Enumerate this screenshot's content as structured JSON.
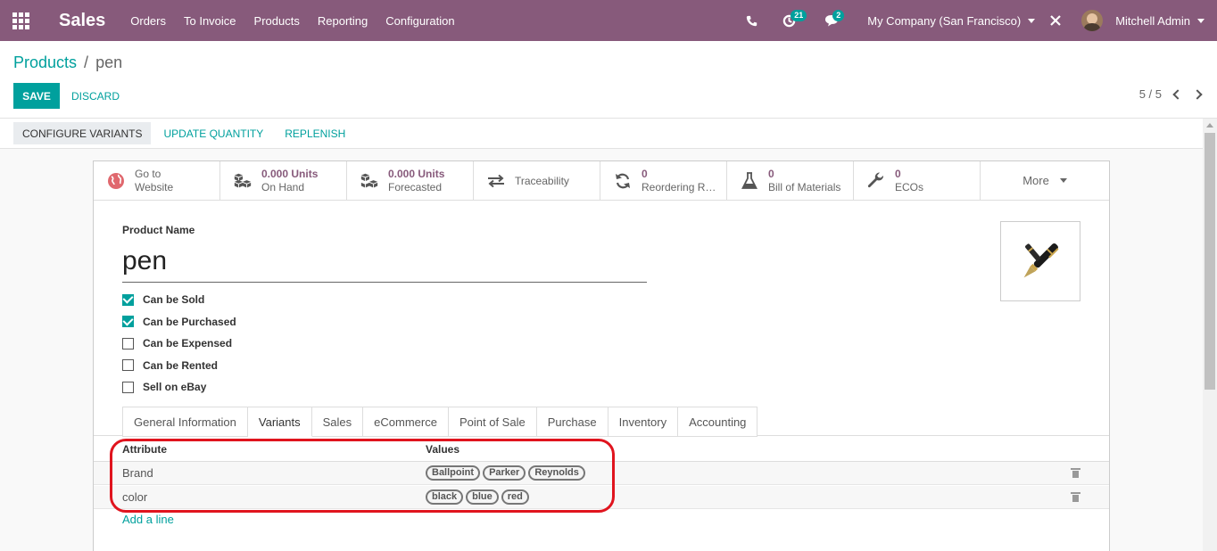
{
  "navbar": {
    "app_name": "Sales",
    "menu": [
      "Orders",
      "To Invoice",
      "Products",
      "Reporting",
      "Configuration"
    ],
    "activity_badge": "21",
    "messages_badge": "2",
    "company": "My Company (San Francisco)",
    "user": "Mitchell Admin",
    "bar_color": "#875a7b"
  },
  "breadcrumb": {
    "parent": "Products",
    "separator": "/",
    "current": "pen"
  },
  "actions": {
    "save": "SAVE",
    "discard": "DISCARD"
  },
  "pager": {
    "value": "5 / 5"
  },
  "statusbar": {
    "configure": "CONFIGURE VARIANTS",
    "update_qty": "UPDATE QUANTITY",
    "replenish": "REPLENISH"
  },
  "smart_buttons": {
    "website": {
      "line1": "Go to",
      "line2": "Website",
      "icon": "globe-icon"
    },
    "on_hand": {
      "value": "0.000 Units",
      "label": "On Hand",
      "icon": "cubes-icon"
    },
    "forecasted": {
      "value": "0.000 Units",
      "label": "Forecasted",
      "icon": "cubes-icon"
    },
    "traceability": {
      "label": "Traceability",
      "icon": "exchange-icon"
    },
    "reordering": {
      "value": "0",
      "label": "Reordering Rules",
      "icon": "refresh-icon"
    },
    "bom": {
      "value": "0",
      "label": "Bill of Materials",
      "icon": "flask-icon"
    },
    "ecos": {
      "value": "0",
      "label": "ECOs",
      "icon": "wrench-icon"
    },
    "more": {
      "label": "More"
    }
  },
  "form": {
    "product_name_label": "Product Name",
    "product_name": "pen",
    "checkboxes": [
      {
        "label": "Can be Sold",
        "checked": true
      },
      {
        "label": "Can be Purchased",
        "checked": true
      },
      {
        "label": "Can be Expensed",
        "checked": false
      },
      {
        "label": "Can be Rented",
        "checked": false
      },
      {
        "label": "Sell on eBay",
        "checked": false
      }
    ]
  },
  "tabs": [
    "General Information",
    "Variants",
    "Sales",
    "eCommerce",
    "Point of Sale",
    "Purchase",
    "Inventory",
    "Accounting"
  ],
  "active_tab": "Variants",
  "variants_table": {
    "headers": {
      "attribute": "Attribute",
      "values": "Values"
    },
    "rows": [
      {
        "attribute": "Brand",
        "values": [
          "Ballpoint",
          "Parker",
          "Reynolds"
        ]
      },
      {
        "attribute": "color",
        "values": [
          "black",
          "blue",
          "red"
        ]
      }
    ],
    "add_line": "Add a line"
  },
  "colors": {
    "accent": "#00a09d",
    "brand": "#875a7b",
    "highlight": "#e0141e"
  }
}
